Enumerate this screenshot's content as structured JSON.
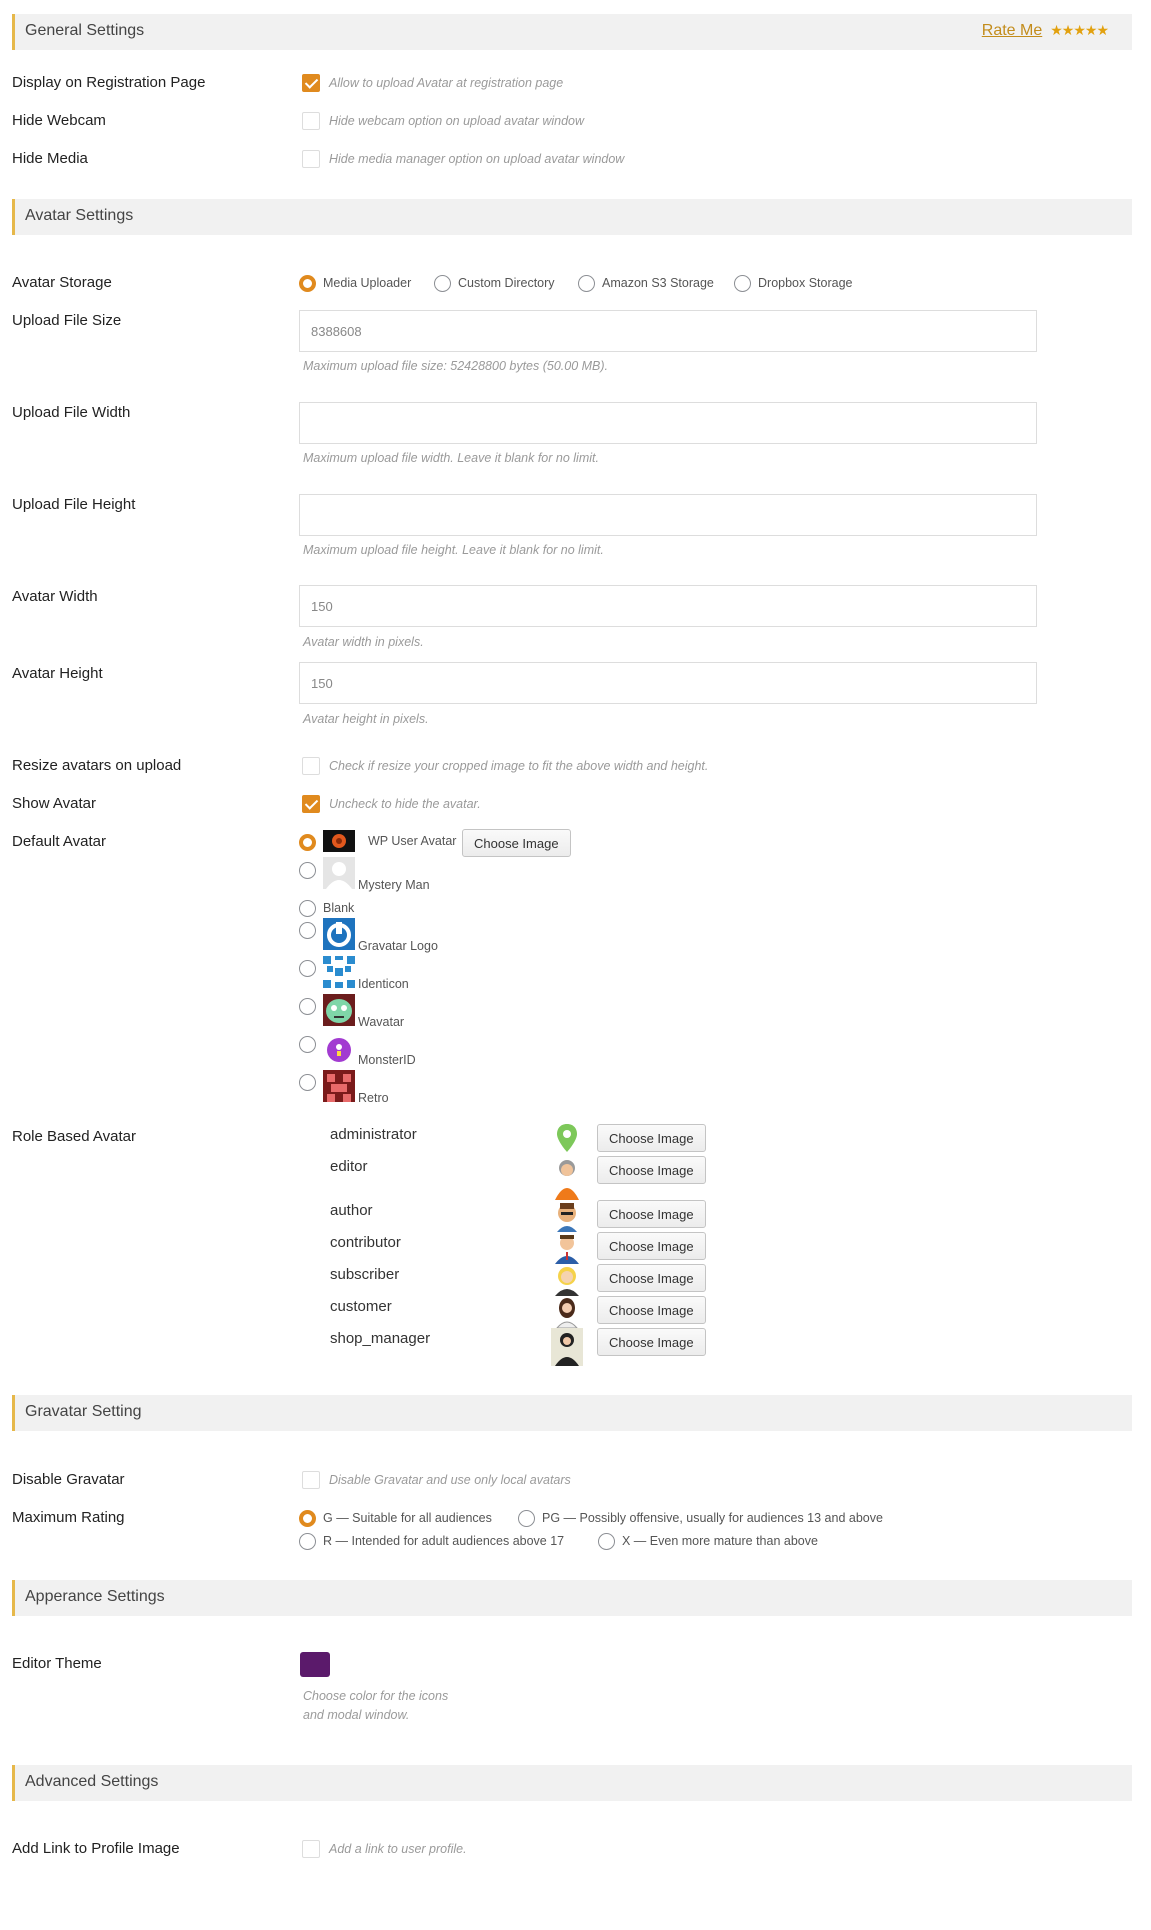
{
  "general": {
    "title": "General Settings",
    "rate_me": "Rate Me",
    "stars": "★★★★★",
    "rows": [
      {
        "label": "Display on Registration Page",
        "text": "Allow to upload Avatar at registration page",
        "checked": true
      },
      {
        "label": "Hide Webcam",
        "text": "Hide webcam option on upload avatar window",
        "checked": false
      },
      {
        "label": "Hide Media",
        "text": "Hide media manager option on upload avatar window",
        "checked": false
      }
    ]
  },
  "avatar": {
    "title": "Avatar Settings",
    "storage_label": "Avatar Storage",
    "storage_options": [
      "Media Uploader",
      "Custom Directory",
      "Amazon S3 Storage",
      "Dropbox Storage"
    ],
    "storage_selected": "Media Uploader",
    "fields": [
      {
        "label": "Upload File Size",
        "value": "8388608",
        "hint": "Maximum upload file size: 52428800 bytes (50.00 MB)."
      },
      {
        "label": "Upload File Width",
        "value": "",
        "hint": "Maximum upload file width. Leave it blank for no limit."
      },
      {
        "label": "Upload File Height",
        "value": "",
        "hint": "Maximum upload file height. Leave it blank for no limit."
      },
      {
        "label": "Avatar Width",
        "value": "150",
        "hint": "Avatar width in pixels."
      },
      {
        "label": "Avatar Height",
        "value": "150",
        "hint": "Avatar height in pixels."
      }
    ],
    "resize_label": "Resize avatars on upload",
    "resize_text": "Check if resize your cropped image to fit the above width and height.",
    "show_label": "Show Avatar",
    "show_text": "Uncheck to hide the avatar.",
    "default_label": "Default Avatar",
    "default_options": [
      "WP User Avatar",
      "Mystery Man",
      "Blank",
      "Gravatar Logo",
      "Identicon",
      "Wavatar",
      "MonsterID",
      "Retro"
    ],
    "default_selected": "WP User Avatar",
    "choose_image": "Choose Image",
    "role_label": "Role Based Avatar",
    "roles": [
      "administrator",
      "editor",
      "author",
      "contributor",
      "subscriber",
      "customer",
      "shop_manager"
    ]
  },
  "gravatar": {
    "title": "Gravatar Setting",
    "disable_label": "Disable Gravatar",
    "disable_text": "Disable Gravatar and use only local avatars",
    "rating_label": "Maximum Rating",
    "ratings": [
      "G — Suitable for all audiences",
      "PG — Possibly offensive, usually for audiences 13 and above",
      "R — Intended for adult audiences above 17",
      "X — Even more mature than above"
    ],
    "rating_selected": "G — Suitable for all audiences"
  },
  "appearance": {
    "title": "Apperance Settings",
    "theme_label": "Editor Theme",
    "theme_color": "#5b1a6b",
    "theme_hint_1": "Choose color for the icons",
    "theme_hint_2": "and modal window."
  },
  "advanced": {
    "title": "Advanced Settings",
    "link_label": "Add Link to Profile Image",
    "link_text": "Add a link to user profile."
  }
}
